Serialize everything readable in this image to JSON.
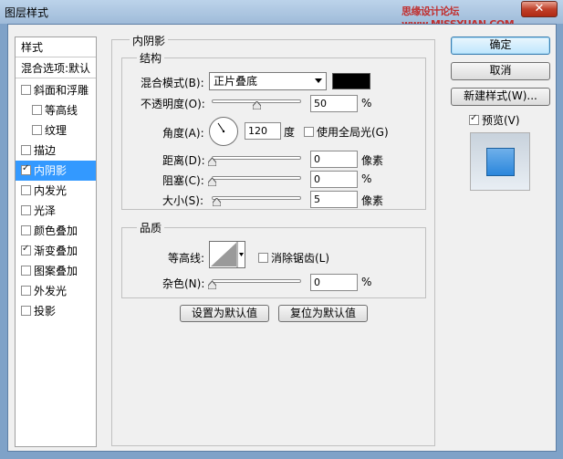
{
  "window": {
    "title": "图层样式",
    "watermark": "思缘设计论坛 www.MISSYUAN.COM",
    "close": "✕"
  },
  "style_list": {
    "header": "样式",
    "blend_default": "混合选项:默认",
    "items": [
      {
        "label": "斜面和浮雕",
        "checked": false
      },
      {
        "label": "等高线",
        "checked": false
      },
      {
        "label": "纹理",
        "checked": false
      },
      {
        "label": "描边",
        "checked": false
      },
      {
        "label": "内阴影",
        "checked": true,
        "selected": true
      },
      {
        "label": "内发光",
        "checked": false
      },
      {
        "label": "光泽",
        "checked": false
      },
      {
        "label": "颜色叠加",
        "checked": false
      },
      {
        "label": "渐变叠加",
        "checked": true
      },
      {
        "label": "图案叠加",
        "checked": false
      },
      {
        "label": "外发光",
        "checked": false
      },
      {
        "label": "投影",
        "checked": false
      }
    ]
  },
  "panel": {
    "title": "内阴影",
    "structure": {
      "title": "结构",
      "blend_mode_label": "混合模式(B):",
      "blend_mode_value": "正片叠底",
      "color": "#000000",
      "opacity_label": "不透明度(O):",
      "opacity_value": "50",
      "opacity_unit": "%",
      "opacity_fraction": 0.5,
      "angle_label": "角度(A):",
      "angle_value": "120",
      "angle_unit": "度",
      "global_light_label": "使用全局光(G)",
      "global_light_checked": false,
      "distance_label": "距离(D):",
      "distance_value": "0",
      "distance_unit": "像素",
      "choke_label": "阻塞(C):",
      "choke_value": "0",
      "choke_unit": "%",
      "size_label": "大小(S):",
      "size_value": "5",
      "size_unit": "像素"
    },
    "quality": {
      "title": "品质",
      "contour_label": "等高线:",
      "anti_alias_label": "消除锯齿(L)",
      "anti_alias_checked": false,
      "noise_label": "杂色(N):",
      "noise_value": "0",
      "noise_unit": "%"
    },
    "set_default": "设置为默认值",
    "reset_default": "复位为默认值"
  },
  "buttons": {
    "ok": "确定",
    "cancel": "取消",
    "new_style": "新建样式(W)...",
    "preview_label": "预览(V)",
    "preview_checked": true
  }
}
